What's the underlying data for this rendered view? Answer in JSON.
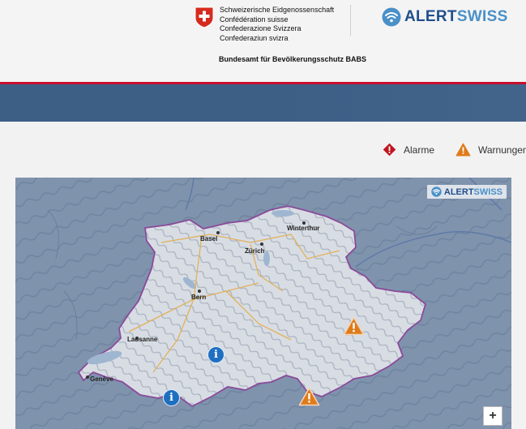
{
  "header": {
    "gov_lines": [
      "Schweizerische Eidgenossenschaft",
      "Confédération suisse",
      "Confederazione Svizzera",
      "Confederaziun svizra"
    ],
    "office": "Bundesamt für Bevölkerungsschutz BABS",
    "logo": {
      "alert": "ALERT",
      "swiss": "SWISS",
      "alert_color": "#1f4e8c",
      "swiss_color": "#4a90c8"
    }
  },
  "legend": {
    "alarm_label": "Alarme",
    "warning_label": "Warnungen"
  },
  "map": {
    "badge": {
      "alert": "ALERT",
      "swiss": "SWISS"
    },
    "zoom_in": "+",
    "cities": [
      "Basel",
      "Winterthur",
      "Zürich",
      "Bern",
      "Lausanne",
      "Genève"
    ],
    "info_marker_symbol": "i"
  },
  "colors": {
    "red": "#c8102e",
    "blue_bar": "#3d5f86",
    "warning": "#e07b1a",
    "alarm": "#c0151f",
    "info": "#1f6fc0"
  }
}
